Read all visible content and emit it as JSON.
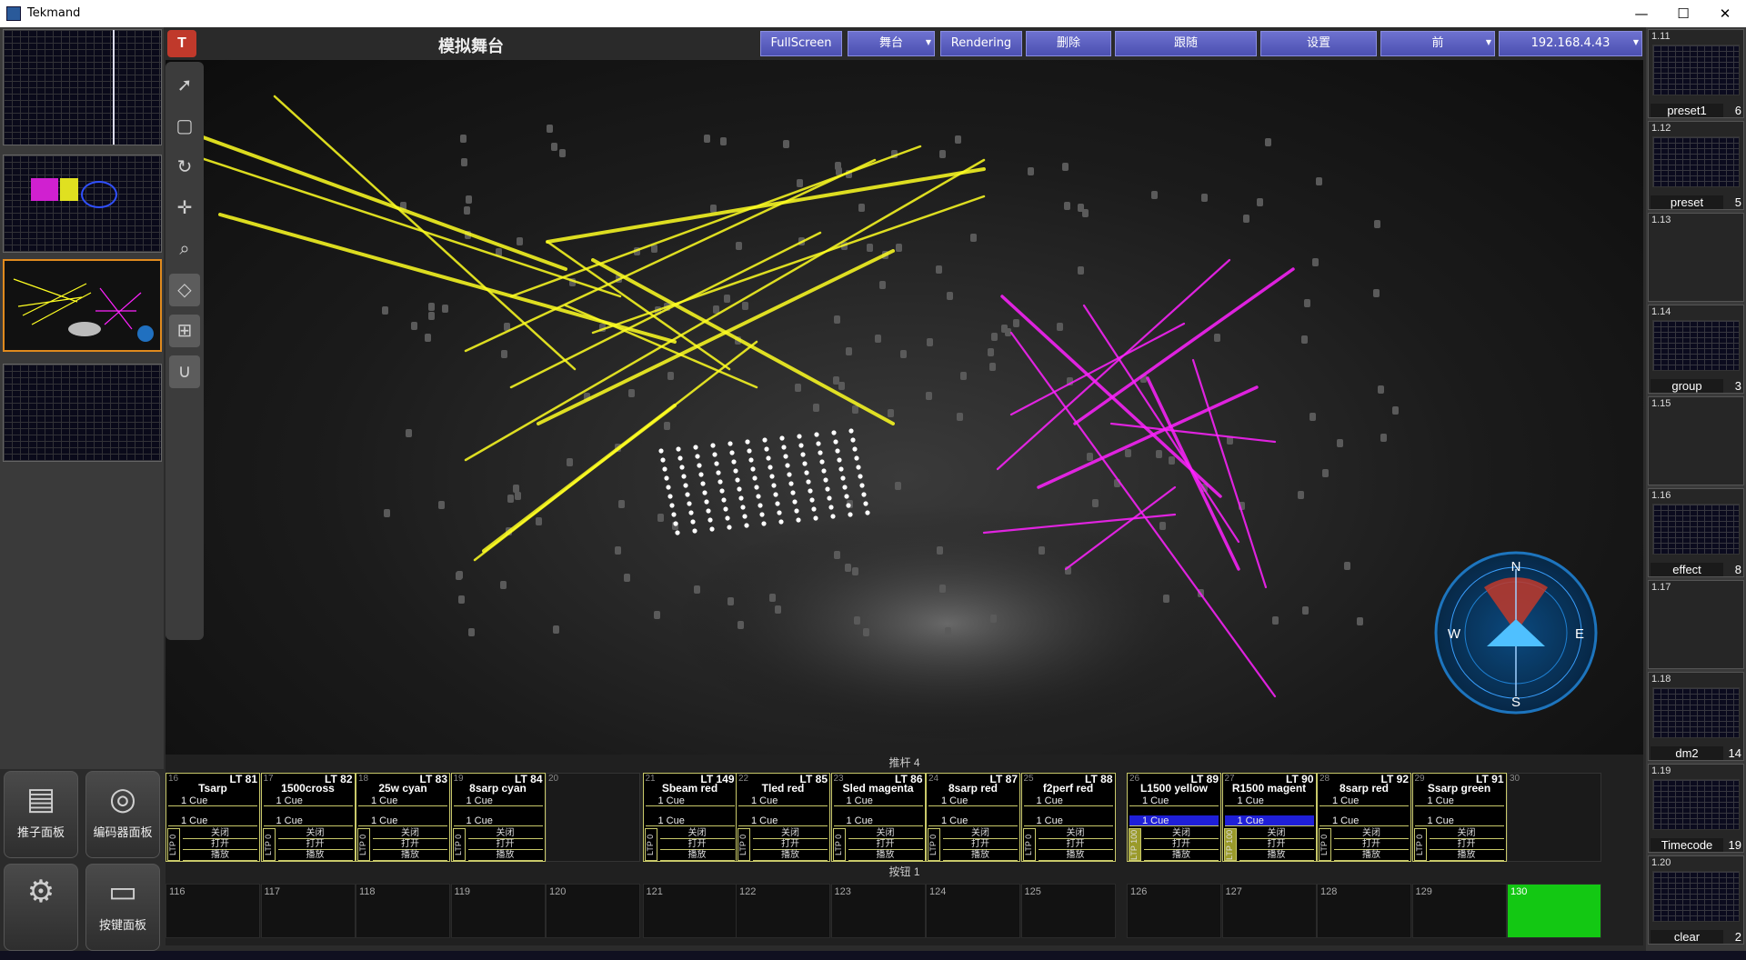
{
  "window": {
    "title": "Tekmand",
    "minimize": "—",
    "maximize": "☐",
    "close": "✕"
  },
  "header": {
    "logo_text": "T",
    "title": "模拟舞台",
    "buttons": [
      {
        "label": "FullScreen",
        "dropdown": false
      },
      {
        "label": "舞台",
        "dropdown": true
      },
      {
        "label": "Rendering",
        "dropdown": false
      },
      {
        "label": "删除",
        "dropdown": false
      },
      {
        "label": "跟随",
        "dropdown": false
      },
      {
        "label": "设置",
        "dropdown": false
      },
      {
        "label": "前",
        "dropdown": true
      },
      {
        "label": "192.168.4.43",
        "dropdown": true
      }
    ]
  },
  "tools": [
    {
      "icon": "pointer-icon",
      "glyph": "➚"
    },
    {
      "icon": "select-box-icon",
      "glyph": "▢"
    },
    {
      "icon": "rotate-icon",
      "glyph": "↻"
    },
    {
      "icon": "move-icon",
      "glyph": "✛"
    },
    {
      "icon": "zoom-icon",
      "glyph": "⌕"
    },
    {
      "icon": "floor-plane-icon",
      "glyph": "◇"
    },
    {
      "icon": "grid-icon",
      "glyph": "⊞"
    },
    {
      "icon": "magnet-icon",
      "glyph": "∪"
    }
  ],
  "compass": {
    "n": "N",
    "s": "S",
    "e": "E",
    "w": "W"
  },
  "fader_section": {
    "title": "推杆 4",
    "faders": [
      {
        "num": "16",
        "code": "LT 81",
        "name": "Tsarp",
        "cue1": "1 Cue",
        "cue2": "1 Cue",
        "ltp": "LTP 0",
        "highlight": false
      },
      {
        "num": "17",
        "code": "LT 82",
        "name": "1500cross",
        "cue1": "1 Cue",
        "cue2": "1 Cue",
        "ltp": "LTP 0",
        "highlight": false
      },
      {
        "num": "18",
        "code": "LT 83",
        "name": "25w cyan",
        "cue1": "1 Cue",
        "cue2": "1 Cue",
        "ltp": "LTP 0",
        "highlight": false
      },
      {
        "num": "19",
        "code": "LT 84",
        "name": "8sarp cyan",
        "cue1": "1 Cue",
        "cue2": "1 Cue",
        "ltp": "LTP 0",
        "highlight": false
      },
      {
        "num": "20",
        "empty": true
      },
      {
        "num": "21",
        "code": "LT 149",
        "name": "Sbeam red",
        "cue1": "1 Cue",
        "cue2": "1 Cue",
        "ltp": "LTP 0",
        "highlight": false
      },
      {
        "num": "22",
        "code": "LT 85",
        "name": "Tled red",
        "cue1": "1 Cue",
        "cue2": "1 Cue",
        "ltp": "LTP 0",
        "highlight": false
      },
      {
        "num": "23",
        "code": "LT 86",
        "name": "Sled magenta",
        "cue1": "1 Cue",
        "cue2": "1 Cue",
        "ltp": "LTP 0",
        "highlight": false
      },
      {
        "num": "24",
        "code": "LT 87",
        "name": "8sarp red",
        "cue1": "1 Cue",
        "cue2": "1 Cue",
        "ltp": "LTP 0",
        "highlight": false
      },
      {
        "num": "25",
        "code": "LT 88",
        "name": "f2perf red",
        "cue1": "1 Cue",
        "cue2": "1 Cue",
        "ltp": "LTP 0",
        "highlight": false
      },
      {
        "num": "26",
        "code": "LT 89",
        "name": "L1500 yellow",
        "cue1": "1 Cue",
        "cue2": "1 Cue",
        "ltp": "LTP 100",
        "highlight": true
      },
      {
        "num": "27",
        "code": "LT 90",
        "name": "R1500 magent",
        "cue1": "1 Cue",
        "cue2": "1 Cue",
        "ltp": "LTP 100",
        "highlight": true
      },
      {
        "num": "28",
        "code": "LT 92",
        "name": "8sarp red",
        "cue1": "1 Cue",
        "cue2": "1 Cue",
        "ltp": "LTP 0",
        "highlight": false
      },
      {
        "num": "29",
        "code": "LT 91",
        "name": "Ssarp green",
        "cue1": "1 Cue",
        "cue2": "1 Cue",
        "ltp": "LTP 0",
        "highlight": false
      },
      {
        "num": "30",
        "empty": true
      }
    ],
    "actions": [
      "关闭",
      "打开",
      "播放"
    ]
  },
  "button_section": {
    "title": "按钮 1",
    "buttons": [
      {
        "num": "116"
      },
      {
        "num": "117"
      },
      {
        "num": "118"
      },
      {
        "num": "119"
      },
      {
        "num": "120"
      },
      {
        "num": "121"
      },
      {
        "num": "122"
      },
      {
        "num": "123"
      },
      {
        "num": "124"
      },
      {
        "num": "125"
      },
      {
        "num": "126"
      },
      {
        "num": "127"
      },
      {
        "num": "128"
      },
      {
        "num": "129"
      },
      {
        "num": "130",
        "active": true
      }
    ]
  },
  "left_buttons": [
    {
      "label": "推子面板",
      "icon": "fader-panel-icon",
      "glyph": "▤"
    },
    {
      "label": "编码器面板",
      "icon": "encoder-panel-icon",
      "glyph": "◎"
    },
    {
      "label": "",
      "icon": "gear-icon",
      "glyph": "⚙"
    },
    {
      "label": "按键面板",
      "icon": "key-panel-icon",
      "glyph": "▭"
    }
  ],
  "right_slots": [
    {
      "id": "1.11",
      "name": "preset1",
      "count": "6",
      "filled": true
    },
    {
      "id": "1.12",
      "name": "preset",
      "count": "5",
      "filled": true
    },
    {
      "id": "1.13",
      "name": "",
      "count": "",
      "filled": false
    },
    {
      "id": "1.14",
      "name": "group",
      "count": "3",
      "filled": true
    },
    {
      "id": "1.15",
      "name": "",
      "count": "",
      "filled": false
    },
    {
      "id": "1.16",
      "name": "effect",
      "count": "8",
      "filled": true
    },
    {
      "id": "1.17",
      "name": "",
      "count": "",
      "filled": false
    },
    {
      "id": "1.18",
      "name": "dm2",
      "count": "14",
      "filled": true
    },
    {
      "id": "1.19",
      "name": "Timecode",
      "count": "19",
      "filled": true
    },
    {
      "id": "1.20",
      "name": "clear",
      "count": "2",
      "filled": true
    }
  ],
  "colors": {
    "accent": "#5a5ec8",
    "fader_border": "#c9c96a",
    "active_green": "#13c813",
    "beam_yellow": "#ffff22",
    "beam_magenta": "#ff22ff"
  }
}
